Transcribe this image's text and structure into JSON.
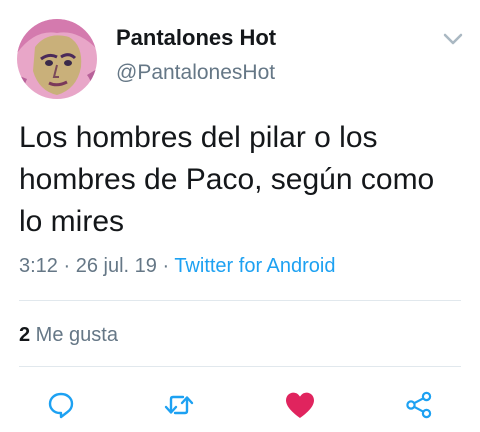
{
  "author": {
    "display_name": "Pantalones Hot",
    "handle": "@PantalonesHot"
  },
  "tweet": {
    "text": "Los hombres del pilar o los hombres de Paco, según como lo mires"
  },
  "meta": {
    "time": "3:12",
    "separator": " · ",
    "date": "26 jul. 19",
    "source": "Twitter for Android"
  },
  "stats": {
    "likes_count": "2",
    "likes_label": " Me gusta"
  },
  "icons": {
    "chevron": "chevron-down-icon",
    "reply": "reply-icon",
    "retweet": "retweet-icon",
    "like": "heart-icon",
    "share": "share-icon"
  },
  "colors": {
    "text": "#14171a",
    "secondary": "#657786",
    "link": "#1da1f2",
    "like": "#e0245e",
    "divider": "#e1e8ed"
  }
}
